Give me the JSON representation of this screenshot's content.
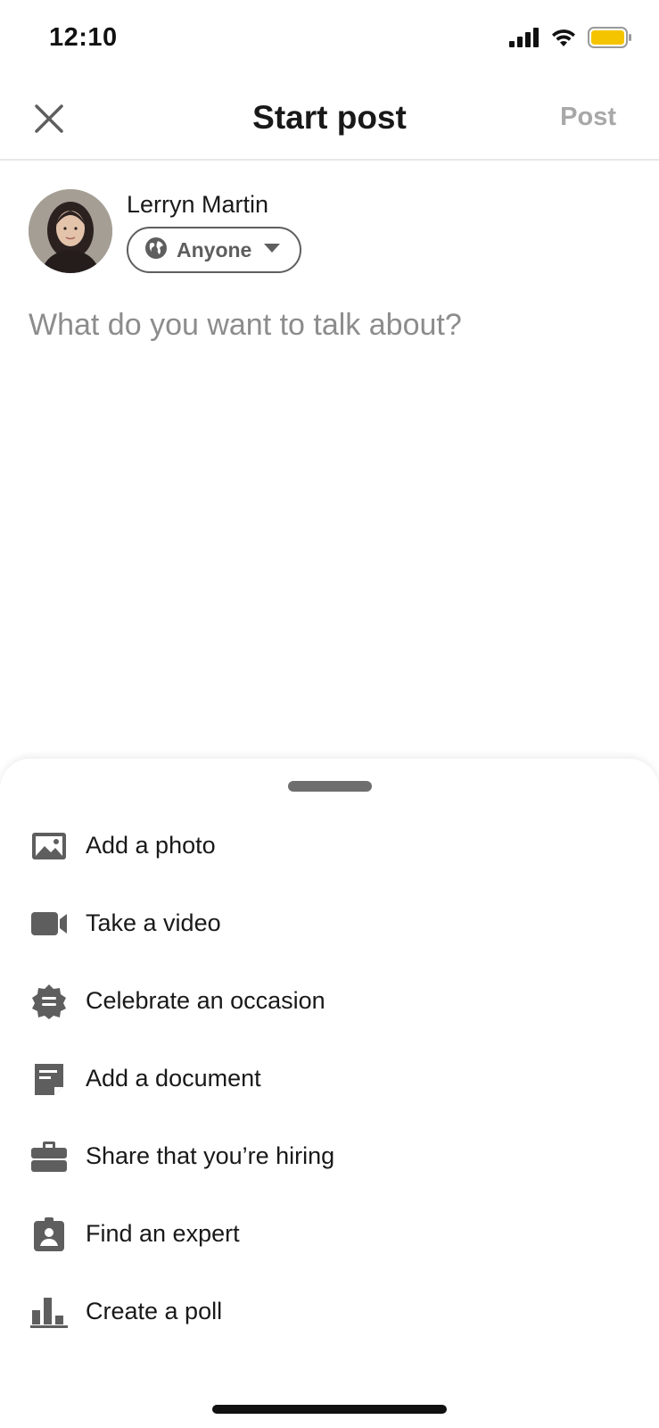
{
  "status": {
    "time": "12:10",
    "icons": [
      "cellular-signal-icon",
      "wifi-icon",
      "battery-icon"
    ],
    "battery_color": "#f5c400"
  },
  "header": {
    "close_icon": "close-icon",
    "title": "Start post",
    "post_label": "Post"
  },
  "author": {
    "name": "Lerryn Martin",
    "visibility": "Anyone",
    "visibility_icon": "globe-icon"
  },
  "composer": {
    "placeholder": "What do you want to talk about?",
    "value": ""
  },
  "actions": [
    {
      "icon": "photo-icon",
      "label": "Add a photo"
    },
    {
      "icon": "video-camera-icon",
      "label": "Take a video"
    },
    {
      "icon": "celebration-badge-icon",
      "label": "Celebrate an occasion"
    },
    {
      "icon": "document-icon",
      "label": "Add a document"
    },
    {
      "icon": "briefcase-icon",
      "label": "Share that you’re hiring"
    },
    {
      "icon": "expert-badge-icon",
      "label": "Find an expert"
    },
    {
      "icon": "poll-icon",
      "label": "Create a poll"
    }
  ],
  "colors": {
    "text": "#191919",
    "icon": "#5e5e5e",
    "muted": "#a8a8a8"
  }
}
